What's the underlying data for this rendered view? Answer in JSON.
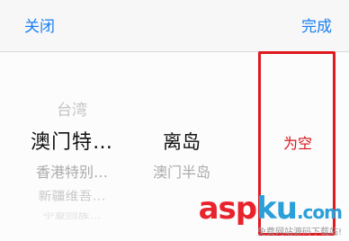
{
  "toolbar": {
    "close_label": "关闭",
    "done_label": "完成"
  },
  "picker": {
    "province_column": {
      "above": "台湾",
      "selected": "澳门特…",
      "below": [
        "香港特别…",
        "新疆维吾…",
        "宁夏回族…"
      ]
    },
    "city_column": {
      "selected": "离岛",
      "below": "澳门半岛"
    },
    "district_column": {
      "selected": "为空"
    }
  },
  "watermark": {
    "logo_part1": "asp",
    "logo_part2": "ku",
    "logo_suffix": ".com",
    "subtitle": "免费网站源码下载站!"
  },
  "colors": {
    "accent": "#1a7ff2",
    "highlight": "#e0191f",
    "selected_text": "#111111"
  }
}
